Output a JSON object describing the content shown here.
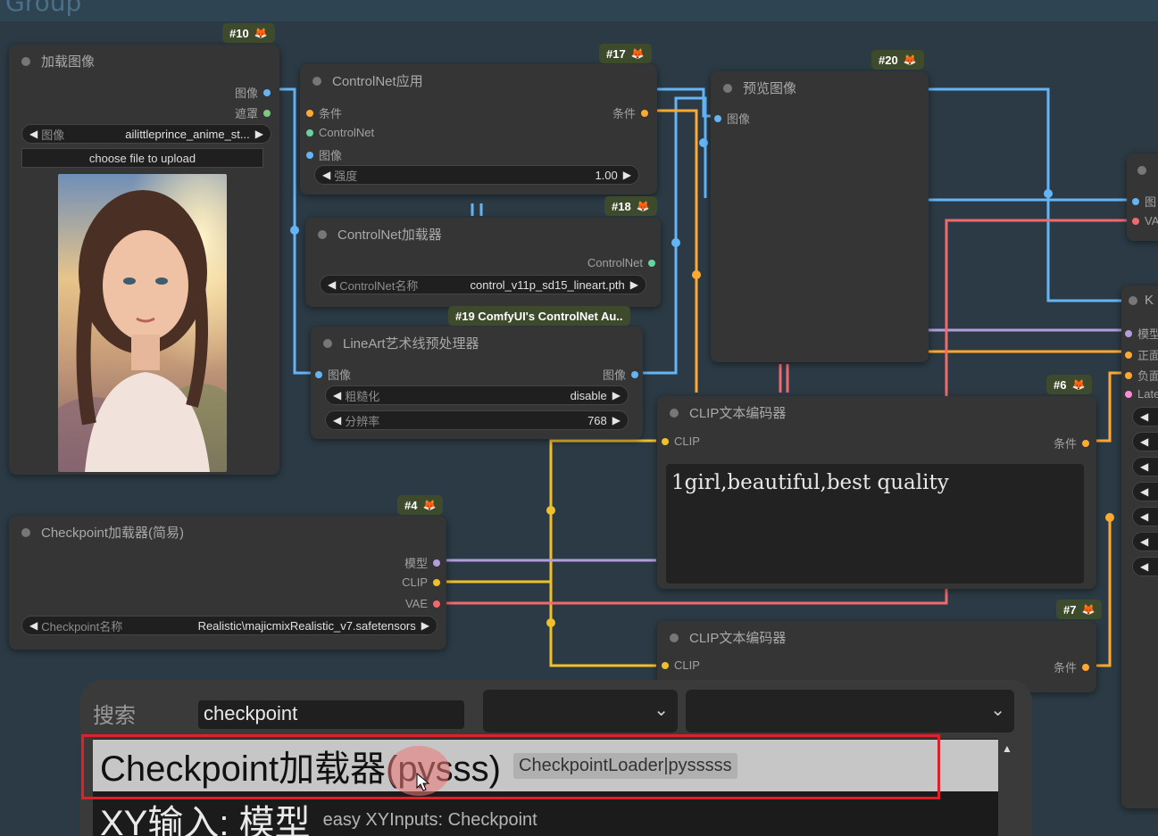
{
  "group": {
    "title": "Group"
  },
  "nodes": {
    "load_image": {
      "badge": "#10",
      "title": "加载图像",
      "outputs": [
        "图像",
        "遮罩"
      ],
      "image_widget": {
        "label": "图像",
        "value": "ailittleprince_anime_st..."
      },
      "upload_label": "choose file to upload"
    },
    "controlnet_apply": {
      "badge": "#17",
      "title": "ControlNet应用",
      "inputs": [
        "条件",
        "ControlNet",
        "图像"
      ],
      "output": "条件",
      "strength": {
        "label": "强度",
        "value": "1.00"
      }
    },
    "controlnet_loader": {
      "badge": "#18",
      "title": "ControlNet加载器",
      "output": "ControlNet",
      "name_widget": {
        "label": "ControlNet名称",
        "value": "control_v11p_sd15_lineart.pth"
      }
    },
    "lineart": {
      "badge": "#19 ComfyUI's ControlNet Au..",
      "title": "LineArt艺术线预处理器",
      "input": "图像",
      "output": "图像",
      "coarse": {
        "label": "粗糙化",
        "value": "disable"
      },
      "resolution": {
        "label": "分辨率",
        "value": "768"
      }
    },
    "preview": {
      "badge": "#20",
      "title": "预览图像",
      "input": "图像"
    },
    "checkpoint": {
      "badge": "#4",
      "title": "Checkpoint加载器(简易)",
      "outputs": [
        "模型",
        "CLIP",
        "VAE"
      ],
      "ckpt_widget": {
        "label": "Checkpoint名称",
        "value": "Realistic\\majicmixRealistic_v7.safetensors"
      }
    },
    "clip_pos": {
      "badge": "#6",
      "title": "CLIP文本编码器",
      "input": "CLIP",
      "output": "条件",
      "text": "1girl,beautiful,best quality"
    },
    "clip_neg": {
      "badge": "#7",
      "title": "CLIP文本编码器",
      "input": "CLIP",
      "output": "条件"
    },
    "right_partial_a": {
      "inputs": [
        "图",
        "VA"
      ]
    },
    "right_partial_b": {
      "title": "K",
      "inputs": [
        "模型",
        "正面",
        "负面",
        "Late"
      ]
    }
  },
  "search": {
    "label": "搜索",
    "query": "checkpoint",
    "results": [
      {
        "name": "Checkpoint加载器(pysss)",
        "desc": "CheckpointLoader|pysssss"
      },
      {
        "name": "XY输入: 模型",
        "desc": "easy XYInputs: Checkpoint"
      }
    ]
  },
  "colors": {
    "model": "#b39ddb",
    "clip": "#f0c02a",
    "vae": "#f0696c",
    "image": "#64b5f6",
    "controlnet": "#66d3a0",
    "conditioning": "#ffa931",
    "mask": "#81c784",
    "latent": "#ff8ad8"
  }
}
